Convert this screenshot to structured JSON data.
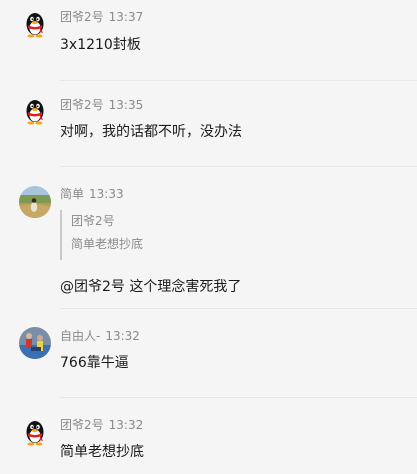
{
  "messages": [
    {
      "sender": "团爷2号",
      "time": "13:37",
      "text": "3x1210封板",
      "avatar": "qq-penguin-icon"
    },
    {
      "sender": "团爷2号",
      "time": "13:35",
      "text": "对啊，我的话都不听，没办法",
      "avatar": "qq-penguin-icon"
    },
    {
      "sender": "简单",
      "time": "13:33",
      "quote": {
        "sender": "团爷2号",
        "text": "简单老想抄底"
      },
      "text": "@团爷2号 这个理念害死我了",
      "avatar": "field-photo-avatar"
    },
    {
      "sender": "自由人-",
      "time": "13:32",
      "text": "766靠牛逼",
      "avatar": "sports-photo-avatar"
    },
    {
      "sender": "团爷2号",
      "time": "13:32",
      "text": "简单老想抄底",
      "avatar": "qq-penguin-icon"
    }
  ]
}
